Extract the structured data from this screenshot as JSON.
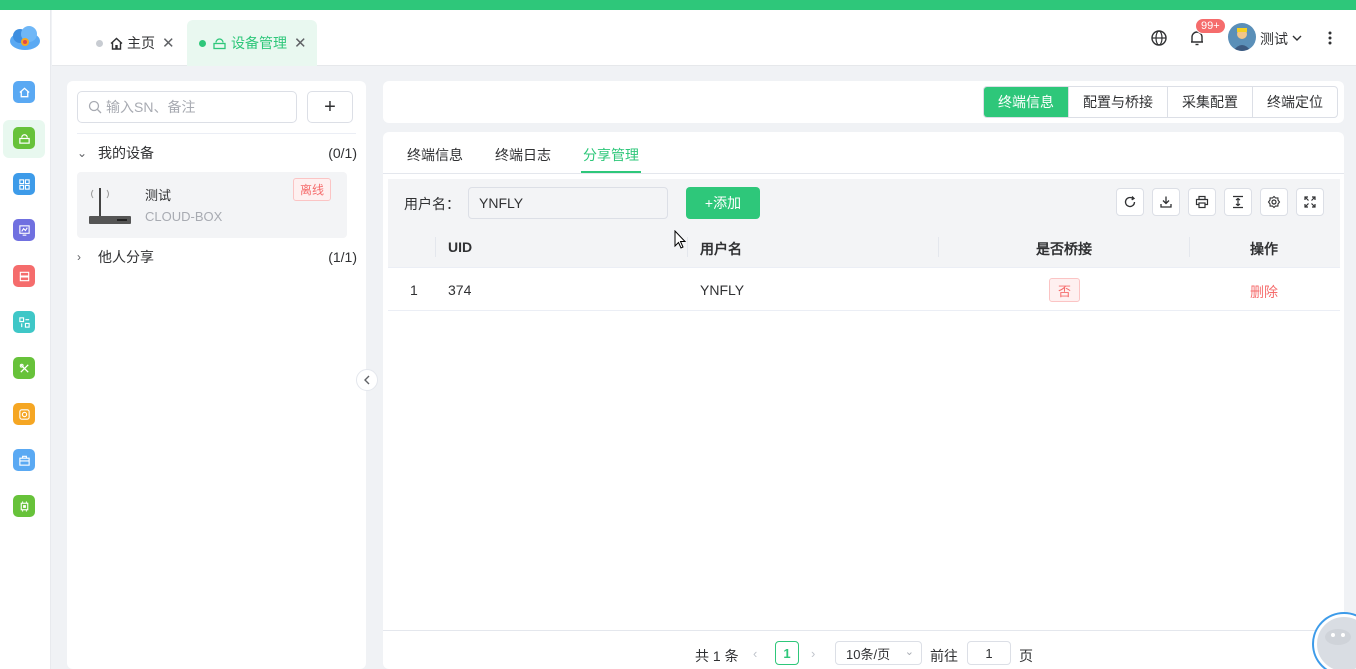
{
  "rail": {
    "icons": [
      {
        "name": "home-icon",
        "color": "#5aa9f3"
      },
      {
        "name": "device-icon",
        "color": "#67c23a"
      },
      {
        "name": "grid-icon",
        "color": "#3d9be9"
      },
      {
        "name": "chart-icon",
        "color": "#7070e0"
      },
      {
        "name": "storage-icon",
        "color": "#f56c6c"
      },
      {
        "name": "transfer-icon",
        "color": "#3fc7c7"
      },
      {
        "name": "tools-icon",
        "color": "#67c23a"
      },
      {
        "name": "camera-icon",
        "color": "#f5a623"
      },
      {
        "name": "briefcase-icon",
        "color": "#5aa9f3"
      },
      {
        "name": "chip-icon",
        "color": "#67c23a"
      }
    ]
  },
  "header": {
    "tabs": [
      {
        "label": "主页"
      },
      {
        "label": "设备管理"
      }
    ],
    "notification_badge": "99+",
    "username": "测试"
  },
  "left": {
    "search_placeholder": "输入SN、备注",
    "add_label": "+",
    "groups": [
      {
        "label": "我的设备",
        "count": "(0/1)"
      },
      {
        "label": "他人分享",
        "count": "(1/1)"
      }
    ],
    "device": {
      "name": "测试",
      "model": "CLOUD-BOX",
      "status": "离线"
    }
  },
  "segments": [
    "终端信息",
    "配置与桥接",
    "采集配置",
    "终端定位"
  ],
  "subtabs": [
    "终端信息",
    "终端日志",
    "分享管理"
  ],
  "filter": {
    "label": "用户名：",
    "value": "YNFLY",
    "add_label": "+添加"
  },
  "table": {
    "headers": [
      "UID",
      "用户名",
      "是否桥接",
      "操作"
    ],
    "rows": [
      {
        "index": "1",
        "uid": "374",
        "username": "YNFLY",
        "bridged": "否",
        "action": "删除"
      }
    ]
  },
  "pager": {
    "total": "共 1 条",
    "page": "1",
    "page_size": "10条/页",
    "goto_label": "前往",
    "goto_value": "1",
    "page_suffix": "页"
  },
  "colors": {
    "accent": "#2ec77a",
    "danger": "#f56c6c"
  }
}
